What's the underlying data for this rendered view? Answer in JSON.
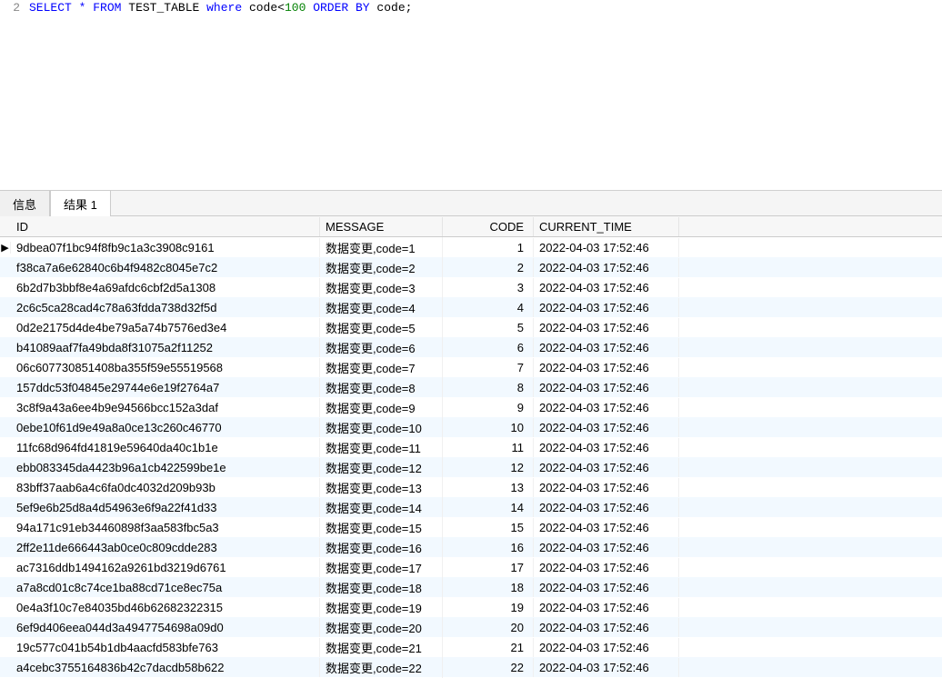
{
  "editor": {
    "line_number": "2",
    "sql_parts": {
      "select": "SELECT",
      "star": "*",
      "from": "FROM",
      "table": "TEST_TABLE",
      "where": "where",
      "condition_col": "code",
      "condition_op": "<",
      "condition_val": "100",
      "orderby": "ORDER BY",
      "order_col": "code",
      "semicolon": ";"
    }
  },
  "tabs": {
    "info": "信息",
    "result": "结果 1"
  },
  "columns": {
    "id": "ID",
    "message": "MESSAGE",
    "code": "CODE",
    "time": "CURRENT_TIME"
  },
  "marker": "▶",
  "rows": [
    {
      "id": "9dbea07f1bc94f8fb9c1a3c3908c9161",
      "message": "数据变更,code=1",
      "code": "1",
      "time": "2022-04-03 17:52:46"
    },
    {
      "id": "f38ca7a6e62840c6b4f9482c8045e7c2",
      "message": "数据变更,code=2",
      "code": "2",
      "time": "2022-04-03 17:52:46"
    },
    {
      "id": "6b2d7b3bbf8e4a69afdc6cbf2d5a1308",
      "message": "数据变更,code=3",
      "code": "3",
      "time": "2022-04-03 17:52:46"
    },
    {
      "id": "2c6c5ca28cad4c78a63fdda738d32f5d",
      "message": "数据变更,code=4",
      "code": "4",
      "time": "2022-04-03 17:52:46"
    },
    {
      "id": "0d2e2175d4de4be79a5a74b7576ed3e4",
      "message": "数据变更,code=5",
      "code": "5",
      "time": "2022-04-03 17:52:46"
    },
    {
      "id": "b41089aaf7fa49bda8f31075a2f11252",
      "message": "数据变更,code=6",
      "code": "6",
      "time": "2022-04-03 17:52:46"
    },
    {
      "id": "06c607730851408ba355f59e55519568",
      "message": "数据变更,code=7",
      "code": "7",
      "time": "2022-04-03 17:52:46"
    },
    {
      "id": "157ddc53f04845e29744e6e19f2764a7",
      "message": "数据变更,code=8",
      "code": "8",
      "time": "2022-04-03 17:52:46"
    },
    {
      "id": "3c8f9a43a6ee4b9e94566bcc152a3daf",
      "message": "数据变更,code=9",
      "code": "9",
      "time": "2022-04-03 17:52:46"
    },
    {
      "id": "0ebe10f61d9e49a8a0ce13c260c46770",
      "message": "数据变更,code=10",
      "code": "10",
      "time": "2022-04-03 17:52:46"
    },
    {
      "id": "11fc68d964fd41819e59640da40c1b1e",
      "message": "数据变更,code=11",
      "code": "11",
      "time": "2022-04-03 17:52:46"
    },
    {
      "id": "ebb083345da4423b96a1cb422599be1e",
      "message": "数据变更,code=12",
      "code": "12",
      "time": "2022-04-03 17:52:46"
    },
    {
      "id": "83bff37aab6a4c6fa0dc4032d209b93b",
      "message": "数据变更,code=13",
      "code": "13",
      "time": "2022-04-03 17:52:46"
    },
    {
      "id": "5ef9e6b25d8a4d54963e6f9a22f41d33",
      "message": "数据变更,code=14",
      "code": "14",
      "time": "2022-04-03 17:52:46"
    },
    {
      "id": "94a171c91eb34460898f3aa583fbc5a3",
      "message": "数据变更,code=15",
      "code": "15",
      "time": "2022-04-03 17:52:46"
    },
    {
      "id": "2ff2e11de666443ab0ce0c809cdde283",
      "message": "数据变更,code=16",
      "code": "16",
      "time": "2022-04-03 17:52:46"
    },
    {
      "id": "ac7316ddb1494162a9261bd3219d6761",
      "message": "数据变更,code=17",
      "code": "17",
      "time": "2022-04-03 17:52:46"
    },
    {
      "id": "a7a8cd01c8c74ce1ba88cd71ce8ec75a",
      "message": "数据变更,code=18",
      "code": "18",
      "time": "2022-04-03 17:52:46"
    },
    {
      "id": "0e4a3f10c7e84035bd46b62682322315",
      "message": "数据变更,code=19",
      "code": "19",
      "time": "2022-04-03 17:52:46"
    },
    {
      "id": "6ef9d406eea044d3a4947754698a09d0",
      "message": "数据变更,code=20",
      "code": "20",
      "time": "2022-04-03 17:52:46"
    },
    {
      "id": "19c577c041b54b1db4aacfd583bfe763",
      "message": "数据变更,code=21",
      "code": "21",
      "time": "2022-04-03 17:52:46"
    },
    {
      "id": "a4cebc3755164836b42c7dacdb58b622",
      "message": "数据变更,code=22",
      "code": "22",
      "time": "2022-04-03 17:52:46"
    }
  ]
}
